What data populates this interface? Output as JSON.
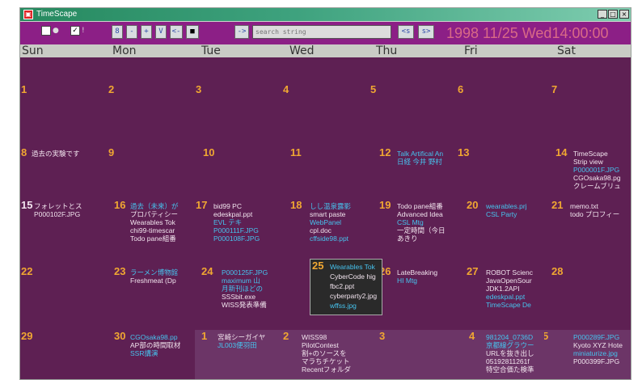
{
  "window": {
    "title": "TimeScape"
  },
  "toolbar": {
    "nav_buttons": [
      "8",
      "-",
      "+",
      "V",
      "<-",
      "■",
      "->"
    ],
    "search_placeholder": "search string",
    "prev_label": "<s",
    "next_label": "s>",
    "datetime": "1998 11/25 Wed14:00:00"
  },
  "days": [
    "Sun",
    "Mon",
    "Tue",
    "Wed",
    "Thu",
    "Fri",
    "Sat"
  ],
  "week1": {
    "d1": "1",
    "d2": "2",
    "d3": "3",
    "d4": "4",
    "d5": "5",
    "d6": "6",
    "d7": "7"
  },
  "week2": {
    "d8": "8",
    "d8_e": [
      "過去の実験です"
    ],
    "d9": "9",
    "d10": "10",
    "d11": "11",
    "d12": "12",
    "d12_e": [
      "Talk Artifical An",
      "日経 今井 野村"
    ],
    "d13": "13",
    "d14": "14",
    "d14_e": [
      "TimeScape",
      "Strip view",
      "P000001F.JPG",
      "CGOsaka98.pg",
      "クレームブリュ"
    ]
  },
  "week3": {
    "d15": "15",
    "d15_e": [
      "フォレットとス",
      "P000102F.JPG"
    ],
    "d16": "16",
    "d16_e": [
      "過去（未来）が",
      "プロパティシー",
      "Wearables Tok",
      "chi99-timescar",
      "Todo pane組番"
    ],
    "d17": "17",
    "d17_e": [
      "bid99 PC",
      "edeskpal.ppt",
      "EVL テキ",
      "P000111F.JPG",
      "P000108F.JPG"
    ],
    "d18": "18",
    "d18_e": [
      "しし温泉露影",
      "smart paste",
      "WebPanel",
      "cpl.doc",
      "cffside98.ppt"
    ],
    "d19": "19",
    "d19_e": [
      "Todo pane組番",
      "Advanced Idea",
      "CSL Mtg",
      "一定時間（今日",
      "あきり"
    ],
    "d20": "20",
    "d20_e": [
      "wearables.prj",
      "CSL Party"
    ],
    "d21": "21",
    "d21_e": [
      "memo.txt",
      "todo プロフィー"
    ]
  },
  "week4": {
    "d22": "22",
    "d23": "23",
    "d23_e": [
      "ラーメン博物館",
      "Freshmeat (Dp"
    ],
    "d24": "24",
    "d24_e": [
      "P000125F.JPG",
      "maximum 山",
      "月新刊ほどの",
      "SSSbit.exe",
      "WISS発表準備"
    ],
    "d25": "25",
    "d25_e": [
      "Wearables Tok",
      "CyberCode hig",
      "fbc2.ppt",
      "cyberparty2.jpg",
      "wffss.jpg"
    ],
    "d26": "26",
    "d26_e": [
      "LateBreaking",
      "HI Mtg"
    ],
    "d27": "27",
    "d27_e": [
      "ROBOT Scienc",
      "JavaOpenSour",
      "JDK1.2API",
      "edeskpal.ppt",
      "TimeScape De"
    ],
    "d28": "28"
  },
  "week5": {
    "d29": "29",
    "d30": "30",
    "d30_e": [
      "CGOsaka98.pp",
      "AP部の時間取材",
      "SSR講演"
    ],
    "n1": "1",
    "n1_e": [
      "宮崎シーガイヤ",
      "JL003便羽田"
    ],
    "n2": "2",
    "n2_e": [
      "WISS98",
      "PilotContest",
      "割+のソースを",
      "マラちチケット",
      "Recentフォルダ"
    ],
    "n3": "3",
    "n4": "4",
    "n4_e": [
      "981204_0736D",
      "京都線グラウー",
      "URLを抜き出し",
      "05192811261f",
      "特空合価た検準"
    ],
    "n5": "5",
    "n5_e": [
      "P000289F.JPG",
      "Kyoto XYZ Hote",
      "miniaturize.jpg",
      "P000399F.JPG"
    ]
  },
  "colors": {
    "calendar_bg": "#5e2053",
    "day_number": "#f0a732",
    "event_white": "#f2e4ee",
    "event_cyan": "#46c3ee",
    "toolbar_bg": "#8c1f86",
    "datetime": "#d96a86"
  }
}
